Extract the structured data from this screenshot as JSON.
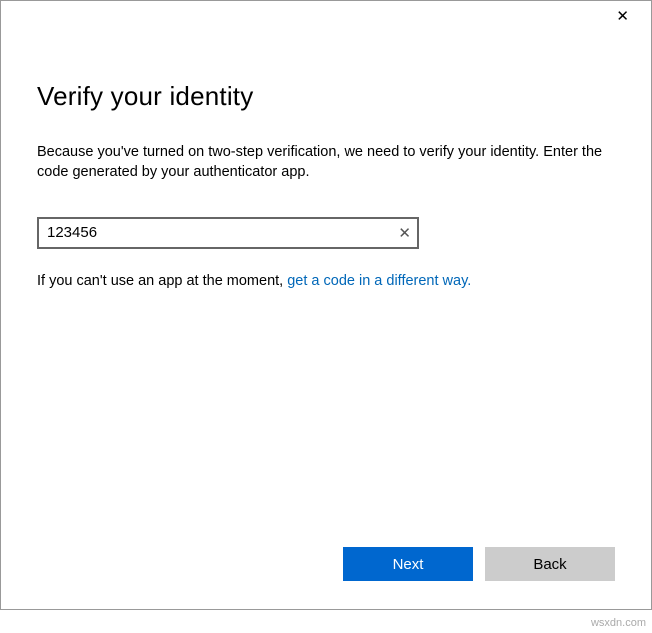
{
  "dialog": {
    "heading": "Verify your identity",
    "description": "Because you've turned on two-step verification, we need to verify your identity. Enter the code generated by your authenticator app.",
    "code_input": {
      "value": "123456",
      "placeholder": ""
    },
    "alt_prefix": "If you can't use an app at the moment, ",
    "alt_link": "get a code in a different way."
  },
  "buttons": {
    "next": "Next",
    "back": "Back"
  },
  "close_glyph": "✕",
  "clear_glyph": "✕",
  "watermark": "wsxdn.com"
}
